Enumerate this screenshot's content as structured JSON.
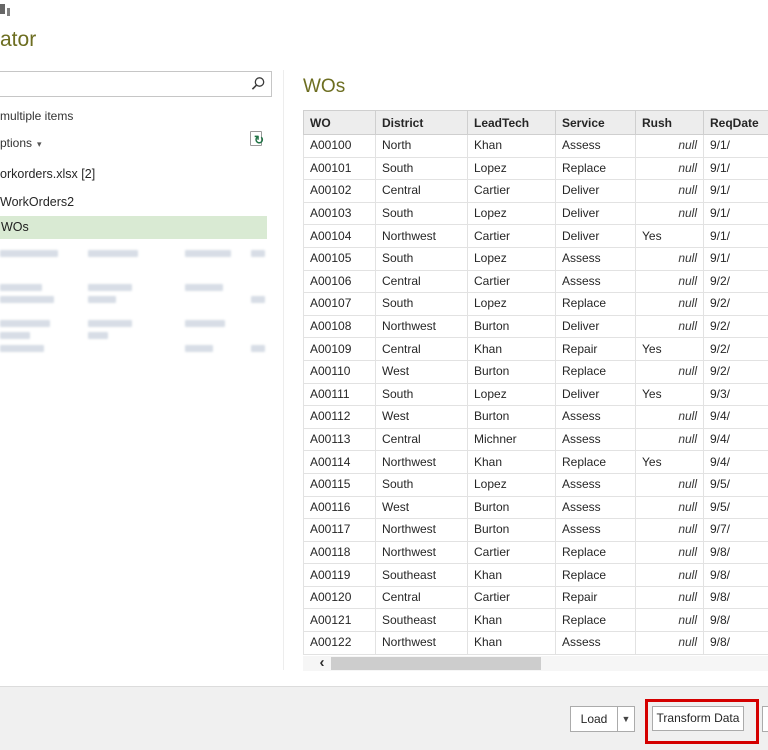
{
  "window": {
    "title_fragment": "ator"
  },
  "sidebar": {
    "search": {
      "value": "",
      "placeholder": ""
    },
    "select_multiple_label": "multiple items",
    "display_options_label": "ptions",
    "items": [
      {
        "label": "orkorders.xlsx [2]"
      },
      {
        "label": "WorkOrders2"
      },
      {
        "label": "WOs",
        "selected": true
      }
    ]
  },
  "preview": {
    "title": "WOs",
    "columns": [
      "WO",
      "District",
      "LeadTech",
      "Service",
      "Rush",
      "ReqDate"
    ],
    "rows": [
      [
        "A00100",
        "North",
        "Khan",
        "Assess",
        "null",
        "9/1/"
      ],
      [
        "A00101",
        "South",
        "Lopez",
        "Replace",
        "null",
        "9/1/"
      ],
      [
        "A00102",
        "Central",
        "Cartier",
        "Deliver",
        "null",
        "9/1/"
      ],
      [
        "A00103",
        "South",
        "Lopez",
        "Deliver",
        "null",
        "9/1/"
      ],
      [
        "A00104",
        "Northwest",
        "Cartier",
        "Deliver",
        "Yes",
        "9/1/"
      ],
      [
        "A00105",
        "South",
        "Lopez",
        "Assess",
        "null",
        "9/1/"
      ],
      [
        "A00106",
        "Central",
        "Cartier",
        "Assess",
        "null",
        "9/2/"
      ],
      [
        "A00107",
        "South",
        "Lopez",
        "Replace",
        "null",
        "9/2/"
      ],
      [
        "A00108",
        "Northwest",
        "Burton",
        "Deliver",
        "null",
        "9/2/"
      ],
      [
        "A00109",
        "Central",
        "Khan",
        "Repair",
        "Yes",
        "9/2/"
      ],
      [
        "A00110",
        "West",
        "Burton",
        "Replace",
        "null",
        "9/2/"
      ],
      [
        "A00111",
        "South",
        "Lopez",
        "Deliver",
        "Yes",
        "9/3/"
      ],
      [
        "A00112",
        "West",
        "Burton",
        "Assess",
        "null",
        "9/4/"
      ],
      [
        "A00113",
        "Central",
        "Michner",
        "Assess",
        "null",
        "9/4/"
      ],
      [
        "A00114",
        "Northwest",
        "Khan",
        "Replace",
        "Yes",
        "9/4/"
      ],
      [
        "A00115",
        "South",
        "Lopez",
        "Assess",
        "null",
        "9/5/"
      ],
      [
        "A00116",
        "West",
        "Burton",
        "Assess",
        "null",
        "9/5/"
      ],
      [
        "A00117",
        "Northwest",
        "Burton",
        "Assess",
        "null",
        "9/7/"
      ],
      [
        "A00118",
        "Northwest",
        "Cartier",
        "Replace",
        "null",
        "9/8/"
      ],
      [
        "A00119",
        "Southeast",
        "Khan",
        "Replace",
        "null",
        "9/8/"
      ],
      [
        "A00120",
        "Central",
        "Cartier",
        "Repair",
        "null",
        "9/8/"
      ],
      [
        "A00121",
        "Southeast",
        "Khan",
        "Replace",
        "null",
        "9/8/"
      ],
      [
        "A00122",
        "Northwest",
        "Khan",
        "Assess",
        "null",
        "9/8/"
      ]
    ]
  },
  "footer": {
    "load_label": "Load",
    "transform_data_label": "Transform Data"
  },
  "icons": {
    "search": "magnifier",
    "display_options_caret": "chevron-down",
    "refresh": "refresh",
    "load_dropdown_caret": "chevron-down",
    "scroll_left": "chevron-left"
  },
  "colors": {
    "accent_title": "#6d6e21",
    "selection_green": "#d9ead3",
    "annotation_red": "#d40000"
  }
}
